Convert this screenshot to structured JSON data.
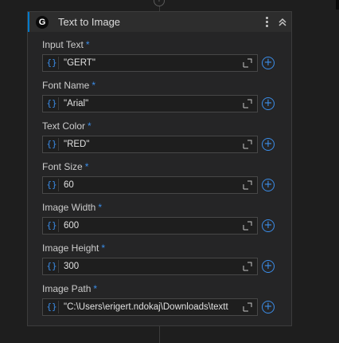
{
  "card": {
    "title": "Text to Image",
    "badge_letter": "G"
  },
  "fields": [
    {
      "label": "Input Text",
      "required_mark": "*",
      "expr_glyph": "{}",
      "value": "\"GERT\""
    },
    {
      "label": "Font Name",
      "required_mark": "*",
      "expr_glyph": "{}",
      "value": "\"Arial\""
    },
    {
      "label": "Text Color",
      "required_mark": "*",
      "expr_glyph": "{}",
      "value": "\"RED\""
    },
    {
      "label": "Font Size",
      "required_mark": "*",
      "expr_glyph": "{}",
      "value": "60"
    },
    {
      "label": "Image Width",
      "required_mark": "*",
      "expr_glyph": "{}",
      "value": "600"
    },
    {
      "label": "Image Height",
      "required_mark": "*",
      "expr_glyph": "{}",
      "value": "300"
    },
    {
      "label": "Image Path",
      "required_mark": "*",
      "expr_glyph": "{}",
      "value": "\"C:\\Users\\erigert.ndokaj\\Downloads\\textt"
    }
  ],
  "icons": {
    "add_node": "plus-circle-icon",
    "menu": "kebab-menu-icon",
    "collapse": "double-chevron-up-icon",
    "expression": "curly-braces-icon",
    "expand": "expand-corner-icon",
    "add_variable": "plus-circle-icon"
  },
  "colors": {
    "accent": "#007acc",
    "required": "#3b8eea",
    "background": "#1e1e1e",
    "card": "#252526"
  }
}
